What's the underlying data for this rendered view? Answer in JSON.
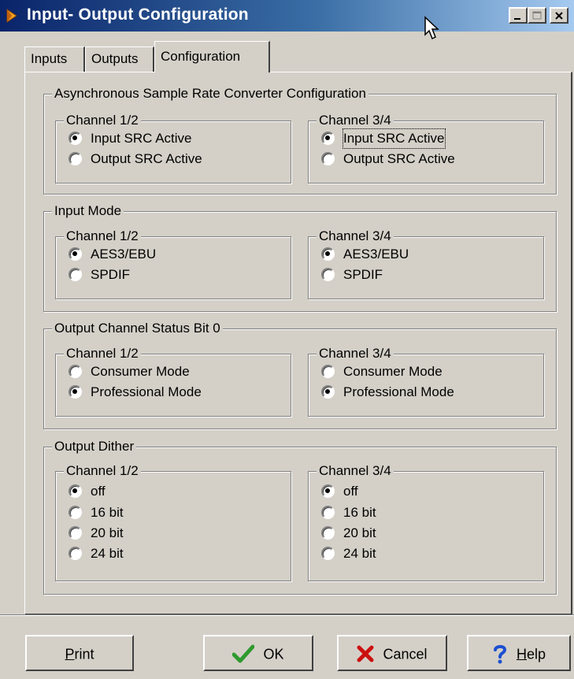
{
  "window": {
    "title": "Input- Output Configuration"
  },
  "tabs": [
    {
      "label": "Inputs",
      "active": false
    },
    {
      "label": "Outputs",
      "active": false
    },
    {
      "label": "Configuration",
      "active": true
    }
  ],
  "groups": {
    "src": {
      "title": "Asynchronous Sample Rate Converter Configuration",
      "ch12": {
        "title": "Channel 1/2",
        "options": [
          "Input SRC Active",
          "Output SRC Active"
        ],
        "selected": 0
      },
      "ch34": {
        "title": "Channel 3/4",
        "options": [
          "Input SRC Active",
          "Output SRC Active"
        ],
        "selected": 0
      }
    },
    "input_mode": {
      "title": "Input Mode",
      "ch12": {
        "title": "Channel 1/2",
        "options": [
          "AES3/EBU",
          "SPDIF"
        ],
        "selected": 0
      },
      "ch34": {
        "title": "Channel 3/4",
        "options": [
          "AES3/EBU",
          "SPDIF"
        ],
        "selected": 0
      }
    },
    "status_bit": {
      "title": "Output Channel Status Bit 0",
      "ch12": {
        "title": "Channel 1/2",
        "options": [
          "Consumer Mode",
          "Professional Mode"
        ],
        "selected": 1
      },
      "ch34": {
        "title": "Channel 3/4",
        "options": [
          "Consumer Mode",
          "Professional Mode"
        ],
        "selected": 1
      }
    },
    "dither": {
      "title": "Output Dither",
      "ch12": {
        "title": "Channel 1/2",
        "options": [
          "off",
          "16 bit",
          "20 bit",
          "24 bit"
        ],
        "selected": 0
      },
      "ch34": {
        "title": "Channel 3/4",
        "options": [
          "off",
          "16 bit",
          "20 bit",
          "24 bit"
        ],
        "selected": 0
      }
    }
  },
  "buttons": {
    "print": {
      "first": "P",
      "rest": "rint"
    },
    "ok": "OK",
    "cancel": "Cancel",
    "help": {
      "first": "H",
      "rest": "elp"
    }
  },
  "colors": {
    "face": "#d4d0c8",
    "titlebar_start": "#0a246a",
    "titlebar_end": "#a6caf0",
    "ok_check": "#2e9a2e",
    "cancel_x": "#cc1010",
    "help_q": "#1c4fd0"
  },
  "icons": {
    "title": "app-icon",
    "minimize": "minimize-icon",
    "maximize": "maximize-icon",
    "close": "close-icon",
    "cursor": "mouse-pointer-icon",
    "ok": "checkmark-icon",
    "cancel": "x-icon",
    "help": "question-mark-icon",
    "radio": "radio-button"
  }
}
